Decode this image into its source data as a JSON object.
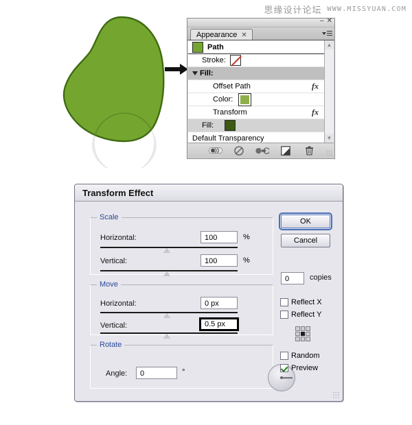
{
  "watermark": {
    "cn_text": "思缘设计论坛",
    "url_text": "WWW.MISSYUAN.COM"
  },
  "artwork": {
    "name": "avocado-shape-preview",
    "fill_color": "#74A62F",
    "stroke_color": "#3F6B12",
    "overlay_circle_color": "#FFFFFF"
  },
  "appearance_panel": {
    "tab_label": "Appearance",
    "tab_close": "✕",
    "minimize": "–",
    "close": "✕",
    "rows": [
      {
        "label": "Path",
        "type": "header",
        "swatch": "#74A62F"
      },
      {
        "label": "Stroke:",
        "type": "stroke-none"
      },
      {
        "label": "Fill:",
        "type": "disclosure-selected"
      },
      {
        "label": "Offset Path",
        "type": "effect",
        "fx": "fx"
      },
      {
        "label": "Color:",
        "type": "color",
        "swatch": "#8FAF4A"
      },
      {
        "label": "Transform",
        "type": "effect",
        "fx": "fx"
      },
      {
        "label": "Fill:",
        "type": "fill",
        "swatch": "#3C5A14"
      },
      {
        "label": "Default Transparency",
        "type": "plain"
      }
    ],
    "footer_icons": [
      "toggle-visibility-icon",
      "clear-appearance-icon",
      "reduce-to-basic-appearance-icon",
      "duplicate-item-icon",
      "delete-item-icon"
    ],
    "scroll_up": "▲",
    "scroll_down": "▼"
  },
  "dialog": {
    "title": "Transform Effect",
    "groups": {
      "scale": {
        "legend": "Scale",
        "horizontal_label": "Horizontal:",
        "horizontal_value": "100",
        "horizontal_unit": "%",
        "vertical_label": "Vertical:",
        "vertical_value": "100",
        "vertical_unit": "%"
      },
      "move": {
        "legend": "Move",
        "horizontal_label": "Horizontal:",
        "horizontal_value": "0 px",
        "vertical_label": "Vertical:",
        "vertical_value": "0.5 px"
      },
      "rotate": {
        "legend": "Rotate",
        "angle_label": "Angle:",
        "angle_value": "0",
        "angle_unit": "°"
      }
    },
    "buttons": {
      "ok": "OK",
      "cancel": "Cancel"
    },
    "copies": {
      "value": "0",
      "label": "copies"
    },
    "checkboxes": [
      {
        "label": "Reflect X",
        "checked": false
      },
      {
        "label": "Reflect Y",
        "checked": false
      },
      {
        "label": "Random",
        "checked": false
      },
      {
        "label": "Preview",
        "checked": true
      }
    ],
    "anchor_widget_name": "transform-origin-anchor"
  }
}
